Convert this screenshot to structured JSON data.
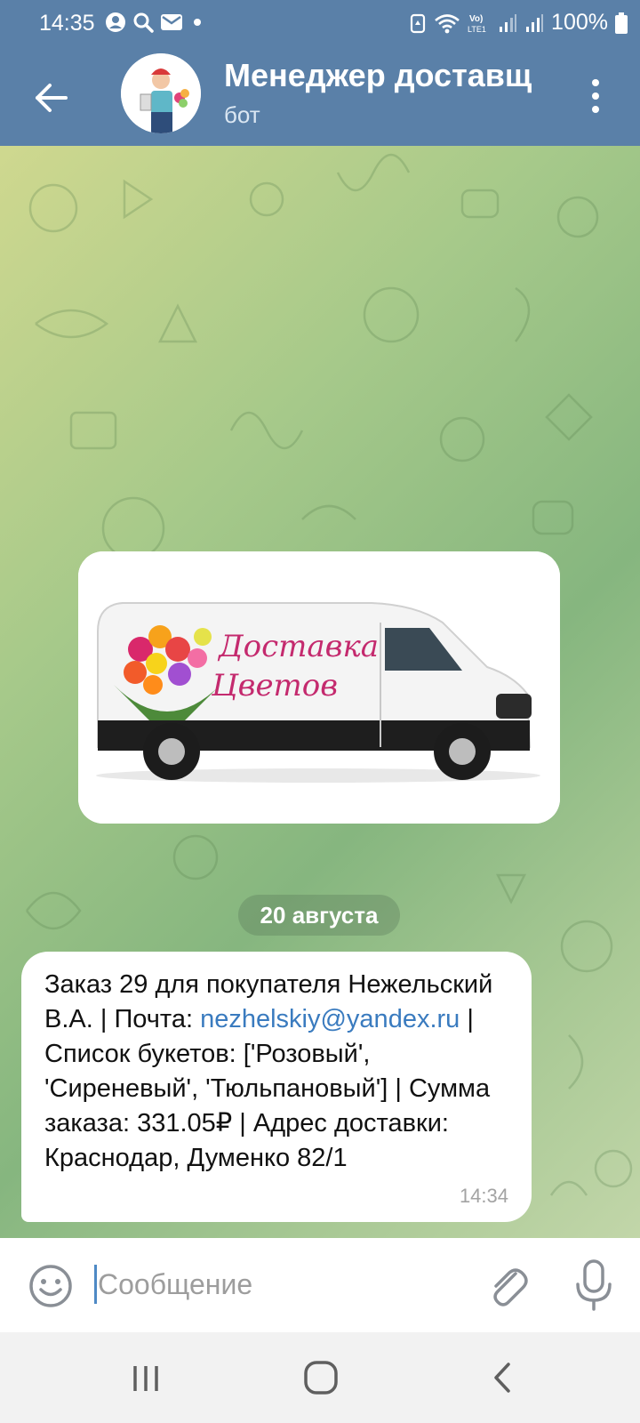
{
  "status_bar": {
    "time": "14:35",
    "battery": "100%",
    "icons": [
      "account-icon",
      "search-icon",
      "mail-icon",
      "notification-dot-icon",
      "battery-saver-icon",
      "wifi-icon",
      "volte-icon",
      "signal-icon",
      "signal-icon",
      "battery-icon"
    ]
  },
  "header": {
    "title": "Менеджер доставщ",
    "subtitle": "бот",
    "back_icon": "arrow-left-icon",
    "menu_icon": "more-vertical-icon"
  },
  "chat": {
    "image_text": "Доставка Цветов",
    "date_separator": "20 августа",
    "message": {
      "part1": "Заказ 29 для покупателя Нежельский В.А. | Почта: ",
      "email": "nezhelskiy@yandex.ru",
      "part2": " | Список букетов: ['Розовый', 'Сиреневый', 'Тюльпановый'] | Сумма заказа: 331.05₽ | Адрес доставки: Краснодар, Думенко 82/1",
      "time": "14:34"
    }
  },
  "composer": {
    "placeholder": "Сообщение",
    "value": "",
    "emoji_icon": "smile-icon",
    "attach_icon": "paperclip-icon",
    "mic_icon": "microphone-icon"
  },
  "nav": {
    "icons": [
      "recent-apps-icon",
      "home-icon",
      "back-icon"
    ]
  },
  "colors": {
    "header": "#5a80a8",
    "link": "#3a7bbf",
    "bubble": "#ffffff"
  }
}
